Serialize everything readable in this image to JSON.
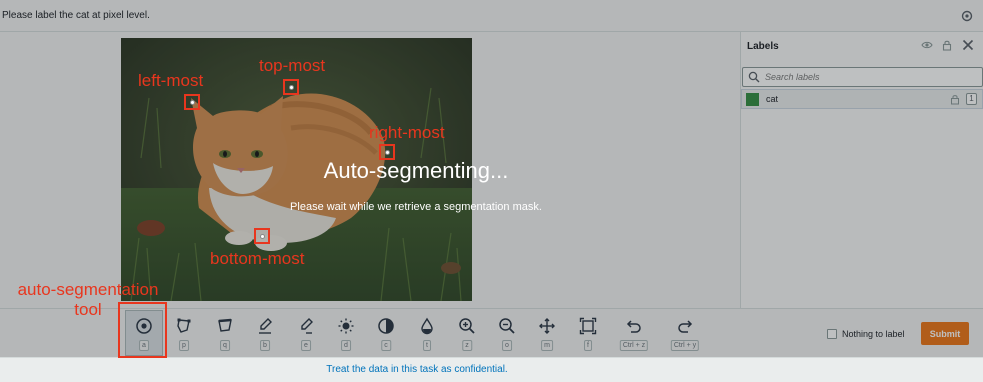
{
  "header": {
    "instruction": "Please label the cat at pixel level."
  },
  "labels_panel": {
    "title": "Labels",
    "search_placeholder": "Search labels",
    "items": [
      {
        "name": "cat",
        "hotkey": "1",
        "color": "#2d8a3d"
      }
    ]
  },
  "overlay": {
    "title": "Auto-segmenting...",
    "subtitle": "Please wait while we retrieve a segmentation mask."
  },
  "toolbar": {
    "tools": [
      {
        "key": "a",
        "icon": "auto-segment-icon",
        "active": true
      },
      {
        "key": "p",
        "icon": "polygon-icon"
      },
      {
        "key": "q",
        "icon": "quick-select-icon"
      },
      {
        "key": "b",
        "icon": "brush-icon"
      },
      {
        "key": "e",
        "icon": "eraser-icon"
      },
      {
        "key": "d",
        "icon": "brightness-icon"
      },
      {
        "key": "c",
        "icon": "contrast-icon"
      },
      {
        "key": "t",
        "icon": "fill-icon"
      },
      {
        "key": "z",
        "icon": "zoom-in-icon"
      },
      {
        "key": "o",
        "icon": "zoom-out-icon"
      },
      {
        "key": "m",
        "icon": "move-icon"
      },
      {
        "key": "f",
        "icon": "fit-icon"
      },
      {
        "key": "Ctrl + z",
        "icon": "undo-icon"
      },
      {
        "key": "Ctrl + y",
        "icon": "redo-icon"
      }
    ],
    "nothing_to_label": "Nothing to label",
    "submit": "Submit"
  },
  "footer": {
    "text": "Treat the data in this task as confidential."
  },
  "annotations": {
    "left_most": "left-most",
    "top_most": "top-most",
    "right_most": "right-most",
    "bottom_most": "bottom-most",
    "auto_segmentation_tool_line1": "auto-segmentation",
    "auto_segmentation_tool_line2": "tool"
  },
  "colors": {
    "accent": "#ec7211",
    "link": "#0073bb",
    "annotation": "#e8361e"
  }
}
